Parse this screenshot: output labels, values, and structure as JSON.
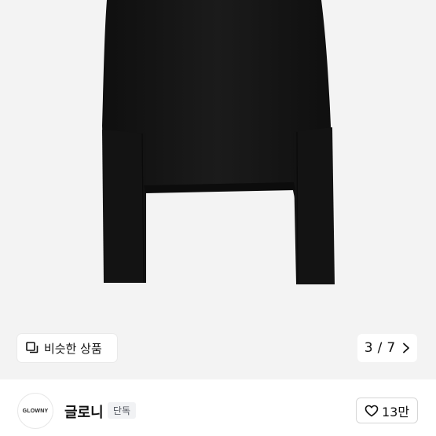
{
  "gallery": {
    "similar_label": "비슷한 상품",
    "current_page": "3",
    "page_separator": "/",
    "total_pages": "7"
  },
  "seller": {
    "logo_text": "GLOWNY",
    "name": "글로니",
    "badge": "단독"
  },
  "like": {
    "count": "13만"
  },
  "colors": {
    "hero_background": "#f3f3f3",
    "garment": "#151515",
    "badge_background": "#f1f2f4"
  },
  "icons": [
    "similar-items-icon",
    "chevron-right-icon",
    "heart-outline-icon"
  ]
}
